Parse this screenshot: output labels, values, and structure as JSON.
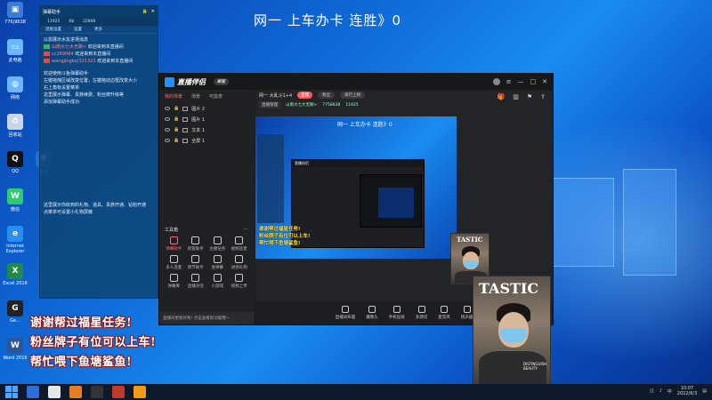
{
  "desktop": {
    "title": "网一 上车办卡 连胜》0",
    "icons": [
      {
        "label": "776|9638",
        "glyph": "▣",
        "color": "#3a7bd5"
      },
      {
        "label": "此电脑",
        "glyph": "▭",
        "color": "#6ab7ff"
      },
      {
        "label": "网络",
        "glyph": "◍",
        "color": "#6ab7ff"
      },
      {
        "label": "回收站",
        "glyph": "♻",
        "color": "#c9d6e8"
      },
      {
        "label": "QQ",
        "glyph": "Q",
        "color": "#111"
      },
      {
        "label": "微信",
        "glyph": "W",
        "color": "#2ecc71"
      },
      {
        "label": "Internet Explorer",
        "glyph": "e",
        "color": "#2a8ef0"
      },
      {
        "label": "Excel 2016",
        "glyph": "X",
        "color": "#1f8a4c"
      },
      {
        "label": "Ge...",
        "glyph": "G",
        "color": "#222"
      },
      {
        "label": "Word 2016",
        "glyph": "W",
        "color": "#2b579a"
      }
    ],
    "security_icon_label": "安全"
  },
  "chat": {
    "title": "弹幕助手",
    "stats": [
      "11925",
      "68",
      "22869"
    ],
    "tabs": [
      "混框设置",
      "设置",
      "更多"
    ],
    "lines_top": [
      {
        "user": "",
        "text": "以恩展示水友进场消息"
      },
      {
        "user": "山南大七大无聊>",
        "text": "欢迎来到本直播间"
      },
      {
        "user": "cc289064",
        "text": "欢迎来到本直播间"
      },
      {
        "user": "wangjingbo|321321",
        "text": "欢迎来到本直播间"
      }
    ],
    "lines_help": [
      "欢迎使用斗鱼弹幕助手",
      "左键拖拽区域改变位置，左键拖动边框改变大小",
      "右上角有设置菜单",
      "这里展示弹幕、贵族续费、粉丝牌升级等",
      "添加弹幕助手成功"
    ],
    "lines_bottom": [
      "这里展示你收到的礼物、道具、贵族开通、钻粉开通",
      "点菜单可设置小礼物屏蔽"
    ]
  },
  "app": {
    "brand": "直播伴侣",
    "badge": "新版",
    "scene_tabs": [
      "我的场景",
      "场景",
      "可能表"
    ],
    "sources": [
      "图片 2",
      "图片 1",
      "文本 1",
      "全屏 1"
    ],
    "tools_title": "工具箱",
    "tools": [
      "弹幕助手",
      "房管助手",
      "主播任务",
      "视频连麦",
      "多人连麦",
      "情节助手",
      "发弹幕",
      "进场礼物",
      "弹幕库",
      "直播对话",
      "小游戏",
      "视频上传"
    ],
    "notice": "直播间更新好啦! 点击查看新功能哦~",
    "topbar": {
      "title": "网一  大乱斗1+4",
      "live_pill": "直播",
      "pill2": "粉丝",
      "pill3": "排行上榜"
    },
    "subbar": {
      "tag": "直播管理",
      "streamer": "山南大七大无聊>",
      "room": "7758638",
      "viewers": "11925"
    },
    "preview_title": "网一 上车办卡 连胜》0",
    "overlay_lines": [
      "谢谢帮过福星任务!",
      "粉丝牌子有位可以上车!",
      "帮忙喂下鱼塘鲨鱼!"
    ],
    "bottom_buttons": [
      "直播间布置",
      "摄像头",
      "手机投屏",
      "多源切",
      "麦克风",
      "扬声器"
    ]
  },
  "overlay": {
    "line1": "谢谢帮过福星任务!",
    "line2": "粉丝牌子有位可以上车!",
    "line3": "帮忙喂下鱼塘鲨鱼!"
  },
  "camera": {
    "label_small": "TASTIC",
    "label_big": "TASTIC",
    "caption": "DISTINGUISH BEAUTY"
  },
  "taskbar": {
    "time": "10:07",
    "date": "2022/6/3"
  }
}
